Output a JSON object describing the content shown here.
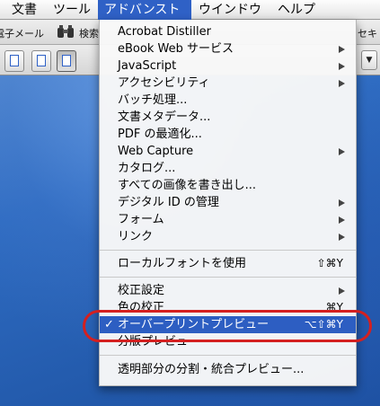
{
  "menubar": {
    "items": [
      {
        "label": "文書"
      },
      {
        "label": "ツール"
      },
      {
        "label": "アドバンスト"
      },
      {
        "label": "ウインドウ"
      },
      {
        "label": "ヘルプ"
      }
    ]
  },
  "toolbar": {
    "email_label": "電子メール",
    "search_label": "検索",
    "right_fragment": "セキ",
    "dropdown_glyph": "▼"
  },
  "menu": {
    "items": [
      {
        "label": "Acrobat Distiller",
        "shortcut": "",
        "submenu": false
      },
      {
        "label": "eBook Web サービス",
        "shortcut": "",
        "submenu": true
      },
      {
        "label": "JavaScript",
        "shortcut": "",
        "submenu": true
      },
      {
        "label": "アクセシビリティ",
        "shortcut": "",
        "submenu": true
      },
      {
        "label": "バッチ処理...",
        "shortcut": "",
        "submenu": false
      },
      {
        "label": "文書メタデータ...",
        "shortcut": "",
        "submenu": false
      },
      {
        "label": "PDF の最適化...",
        "shortcut": "",
        "submenu": false
      },
      {
        "label": "Web Capture",
        "shortcut": "",
        "submenu": true
      },
      {
        "label": "カタログ...",
        "shortcut": "",
        "submenu": false
      },
      {
        "label": "すべての画像を書き出し...",
        "shortcut": "",
        "submenu": false
      },
      {
        "label": "デジタル ID の管理",
        "shortcut": "",
        "submenu": true
      },
      {
        "label": "フォーム",
        "shortcut": "",
        "submenu": true
      },
      {
        "label": "リンク",
        "shortcut": "",
        "submenu": true
      },
      {
        "label": "ローカルフォントを使用",
        "shortcut": "⇧⌘Y",
        "submenu": false
      },
      {
        "label": "校正設定",
        "shortcut": "",
        "submenu": true
      },
      {
        "label": "色の校正",
        "shortcut": "⌘Y",
        "submenu": false
      },
      {
        "label": "オーバープリントプレビュー",
        "shortcut": "⌥⇧⌘Y",
        "submenu": false,
        "checked": true,
        "highlighted": true
      },
      {
        "label": "分版プレビュー",
        "shortcut": "",
        "submenu": false
      },
      {
        "label": "透明部分の分割・統合プレビュー...",
        "shortcut": "",
        "submenu": false
      }
    ],
    "check_glyph": "✓"
  },
  "colors": {
    "menu_highlight": "#2d5ec2",
    "annotation_oval": "#d42020"
  }
}
